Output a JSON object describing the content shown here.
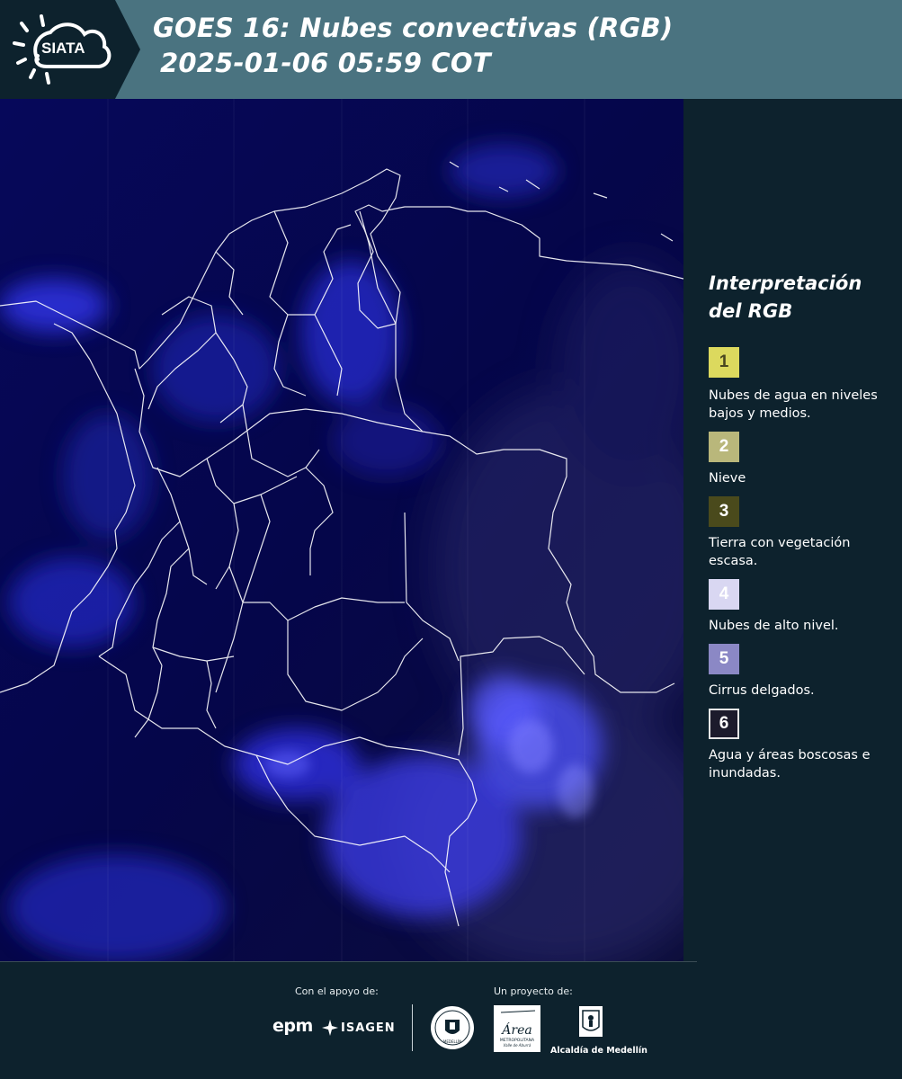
{
  "header": {
    "logo_text": "SIATA",
    "title_line1": "GOES 16: Nubes convectivas (RGB)",
    "title_line2": "2025-01-06 05:59 COT",
    "band_color": "#4a7380",
    "logo_band_color": "#0d222d"
  },
  "legend": {
    "title": "Interpretación\ndel RGB",
    "items": [
      {
        "number": "1",
        "label": "Nubes de agua en niveles bajos y medios.",
        "color": "#dcd95e",
        "text_color": "#4a4720"
      },
      {
        "number": "2",
        "label": "Nieve",
        "color": "#b9b77b",
        "text_color": "#ffffff"
      },
      {
        "number": "3",
        "label": "Tierra con vegetación escasa.",
        "color": "#4a4a1c",
        "text_color": "#ffffff"
      },
      {
        "number": "4",
        "label": "Nubes de alto nivel.",
        "color": "#d9d7f2",
        "text_color": "#ffffff"
      },
      {
        "number": "5",
        "label": "Cirrus delgados.",
        "color": "#8b88c5",
        "text_color": "#ffffff"
      },
      {
        "number": "6",
        "label": "Agua y áreas boscosas e inundadas.",
        "color": "#1c1b2c",
        "text_color": "#ffffff"
      }
    ]
  },
  "map": {
    "background_color": "#05064a",
    "cloud_color": "#3b3cff",
    "border_color": "#ffffff"
  },
  "footer": {
    "support_caption": "Con el apoyo de:",
    "project_caption": "Un proyecto de:",
    "sponsor_epm": "epm",
    "sponsor_isagen": "ISAGEN",
    "partner_area_line1": "Área",
    "partner_area_line2": "METROPOLITANA",
    "partner_area_line3": "Valle de Aburrá",
    "partner_seal_text": "MEDELLÍN",
    "partner_alcaldia": "Alcaldía de Medellín"
  }
}
